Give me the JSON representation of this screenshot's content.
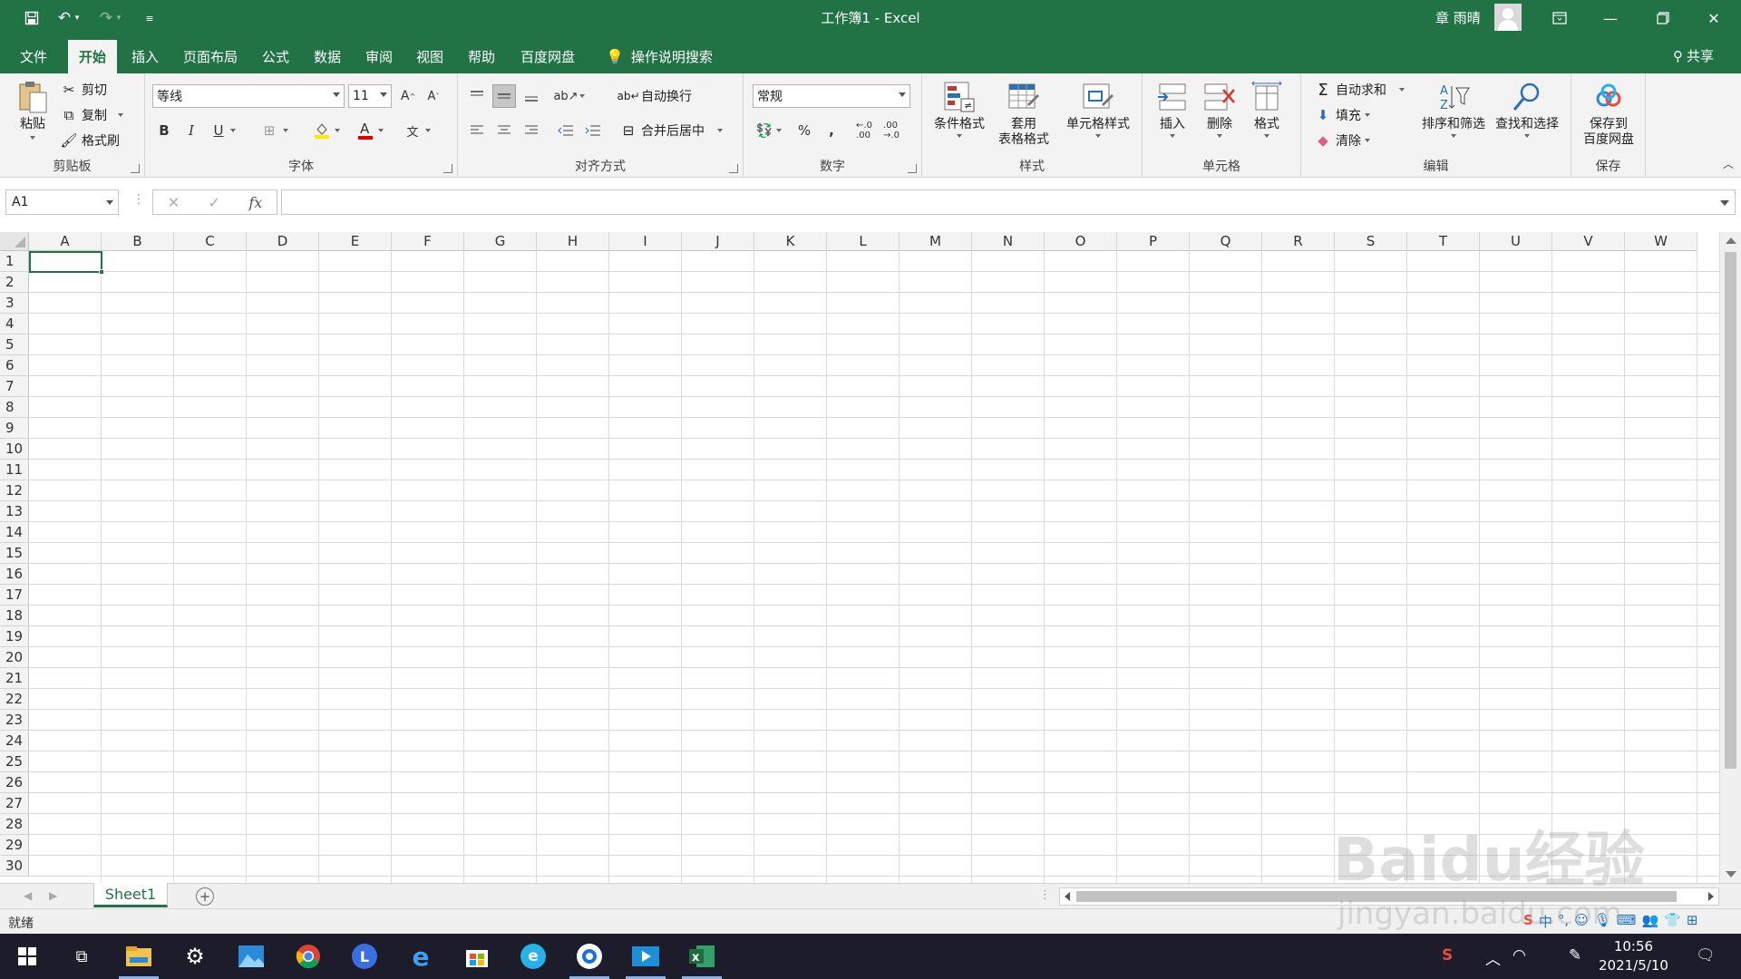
{
  "titlebar": {
    "title": "工作簿1  -  Excel",
    "user": "章 雨晴"
  },
  "tabs": [
    "文件",
    "开始",
    "插入",
    "页面布局",
    "公式",
    "数据",
    "审阅",
    "视图",
    "帮助",
    "百度网盘"
  ],
  "active_tab": "开始",
  "tell_me": "操作说明搜索",
  "share": "共享",
  "ribbon": {
    "clipboard": {
      "label": "剪贴板",
      "paste": "粘贴",
      "cut": "剪切",
      "copy": "复制",
      "format_painter": "格式刷"
    },
    "font": {
      "label": "字体",
      "font_name": "等线",
      "font_size": "11",
      "bold": "B",
      "italic": "I",
      "underline": "U"
    },
    "alignment": {
      "label": "对齐方式",
      "wrap_text": "自动换行",
      "merge_center": "合并后居中"
    },
    "number": {
      "label": "数字",
      "format": "常规"
    },
    "styles": {
      "label": "样式",
      "conditional": "条件格式",
      "table_1": "套用",
      "table_2": "表格格式",
      "cell_styles": "单元格样式"
    },
    "cells": {
      "label": "单元格",
      "insert": "插入",
      "delete": "删除",
      "format": "格式"
    },
    "editing": {
      "label": "编辑",
      "autosum": "自动求和",
      "fill": "填充",
      "clear": "清除",
      "sort_filter": "排序和筛选",
      "find_select": "查找和选择"
    },
    "save": {
      "label": "保存",
      "save_1": "保存到",
      "save_2": "百度网盘"
    }
  },
  "formula_bar": {
    "name_box": "A1",
    "value": ""
  },
  "grid": {
    "columns": [
      "A",
      "B",
      "C",
      "D",
      "E",
      "F",
      "G",
      "H",
      "I",
      "J",
      "K",
      "L",
      "M",
      "N",
      "O",
      "P",
      "Q",
      "R",
      "S",
      "T",
      "U",
      "V",
      "W"
    ],
    "rows": [
      "1",
      "2",
      "3",
      "4",
      "5",
      "6",
      "7",
      "8",
      "9",
      "10",
      "11",
      "12",
      "13",
      "14",
      "15",
      "16",
      "17",
      "18",
      "19",
      "20",
      "21",
      "22",
      "23",
      "24",
      "25",
      "26",
      "27",
      "28",
      "29",
      "30"
    ]
  },
  "sheets": [
    "Sheet1"
  ],
  "status": "就绪",
  "taskbar": {
    "time": "10:56",
    "date": "2021/5/10"
  },
  "watermark": {
    "line1": "Baidu经验",
    "line2": "jingyan.baidu.com"
  },
  "colors": {
    "excel_green": "#217346"
  }
}
